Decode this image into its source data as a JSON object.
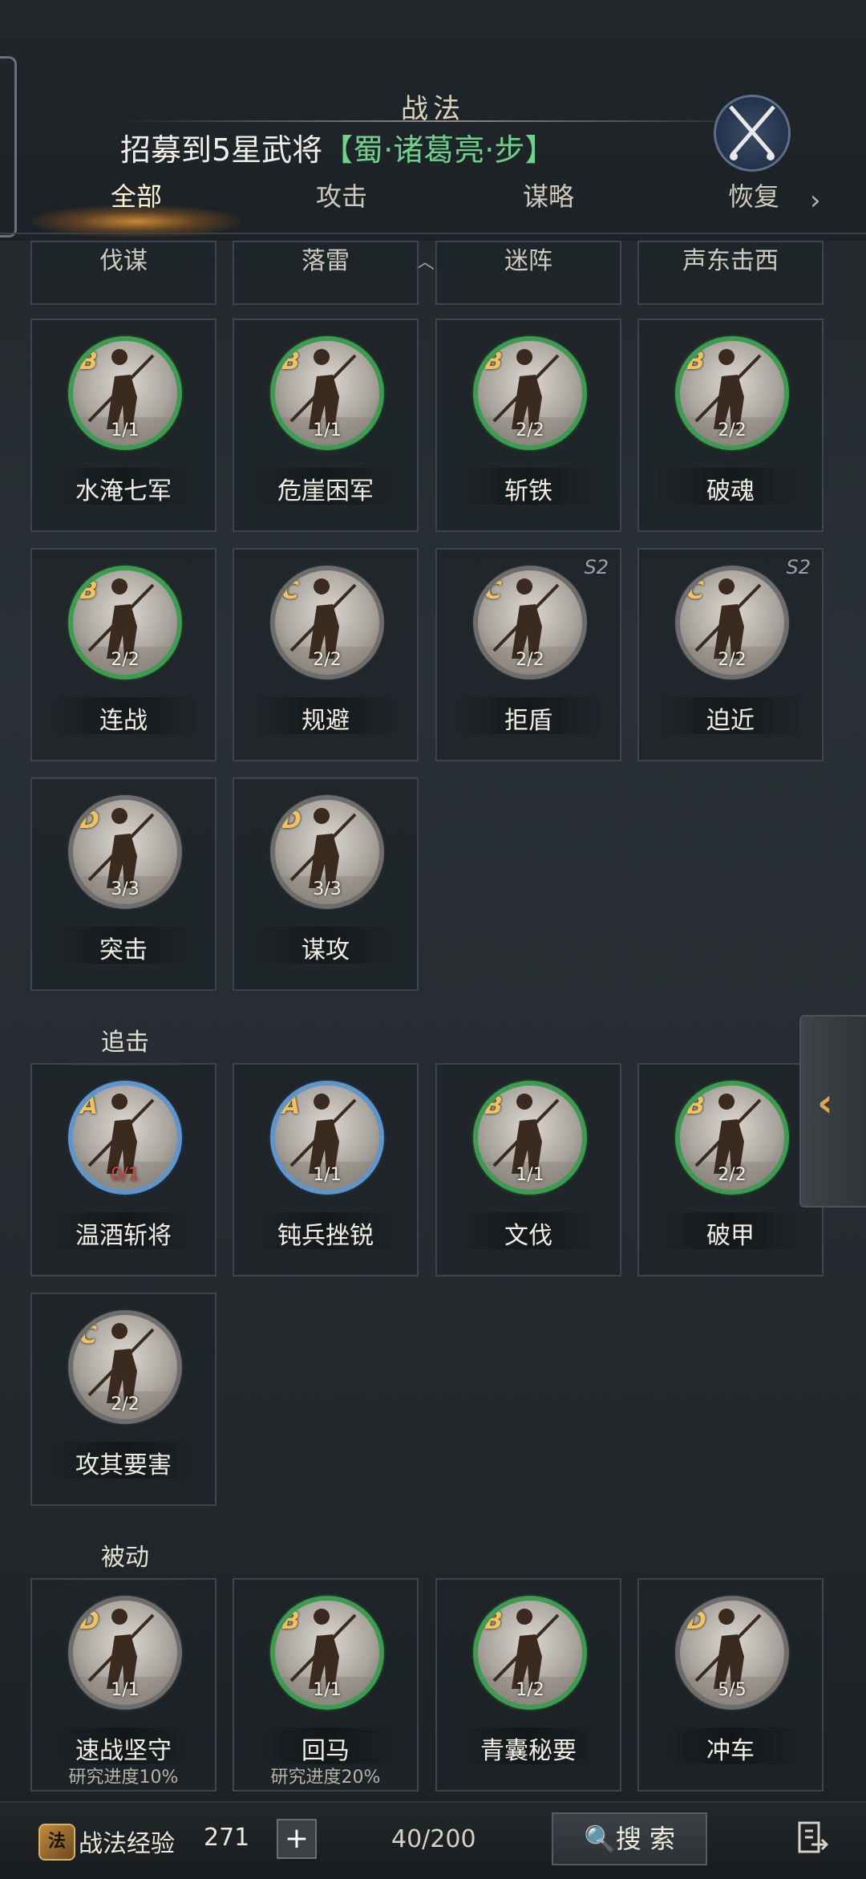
{
  "header": {
    "title": "战法",
    "banner_prefix": "招募到5星武将",
    "banner_highlight": "【蜀·诸葛亮·步】"
  },
  "tabs": [
    {
      "label": "全部",
      "active": true
    },
    {
      "label": "攻击",
      "active": false
    },
    {
      "label": "谋略",
      "active": false
    },
    {
      "label": "恢复",
      "active": false
    }
  ],
  "partial_row": [
    "伐谋",
    "落雷",
    "迷阵",
    "声东击西"
  ],
  "sections": {
    "top_cards": [
      {
        "grade": "B",
        "count": "1/1",
        "name": "水淹七军",
        "ring": "green"
      },
      {
        "grade": "B",
        "count": "1/1",
        "name": "危崖困军",
        "ring": "green"
      },
      {
        "grade": "B",
        "count": "2/2",
        "name": "斩铁",
        "ring": "green"
      },
      {
        "grade": "B",
        "count": "2/2",
        "name": "破魂",
        "ring": "green"
      },
      {
        "grade": "B",
        "count": "2/2",
        "name": "连战",
        "ring": "green"
      },
      {
        "grade": "C",
        "count": "2/2",
        "name": "规避",
        "ring": "silver"
      },
      {
        "grade": "C",
        "count": "2/2",
        "name": "拒盾",
        "ring": "silver",
        "tag": "S2"
      },
      {
        "grade": "C",
        "count": "2/2",
        "name": "迫近",
        "ring": "silver",
        "tag": "S2"
      },
      {
        "grade": "D",
        "count": "3/3",
        "name": "突击",
        "ring": "silver"
      },
      {
        "grade": "D",
        "count": "3/3",
        "name": "谋攻",
        "ring": "silver"
      }
    ],
    "pursuit": {
      "label": "追击",
      "cards": [
        {
          "grade": "A",
          "count": "0/1",
          "name": "温酒斩将",
          "ring": "blue"
        },
        {
          "grade": "A",
          "count": "1/1",
          "name": "钝兵挫锐",
          "ring": "blue"
        },
        {
          "grade": "B",
          "count": "1/1",
          "name": "文伐",
          "ring": "green"
        },
        {
          "grade": "B",
          "count": "2/2",
          "name": "破甲",
          "ring": "green"
        },
        {
          "grade": "C",
          "count": "2/2",
          "name": "攻其要害",
          "ring": "silver"
        }
      ]
    },
    "passive": {
      "label": "被动",
      "cards": [
        {
          "grade": "D",
          "count": "1/1",
          "name": "速战坚守",
          "ring": "silver",
          "sub": "研究进度10%"
        },
        {
          "grade": "B",
          "count": "1/1",
          "name": "回马",
          "ring": "green",
          "sub": "研究进度20%"
        },
        {
          "grade": "B",
          "count": "1/2",
          "name": "青囊秘要",
          "ring": "green"
        },
        {
          "grade": "D",
          "count": "5/5",
          "name": "冲车",
          "ring": "silver"
        }
      ]
    }
  },
  "footer": {
    "exp_label": "战法经验",
    "exp_value": "271",
    "plus_label": "+",
    "page_count": "40/200",
    "search_label": "搜 索"
  },
  "icons": [
    "swords-icon",
    "chevron-right-icon",
    "chevron-left-icon",
    "search-icon",
    "exit-icon",
    "exp-icon"
  ]
}
